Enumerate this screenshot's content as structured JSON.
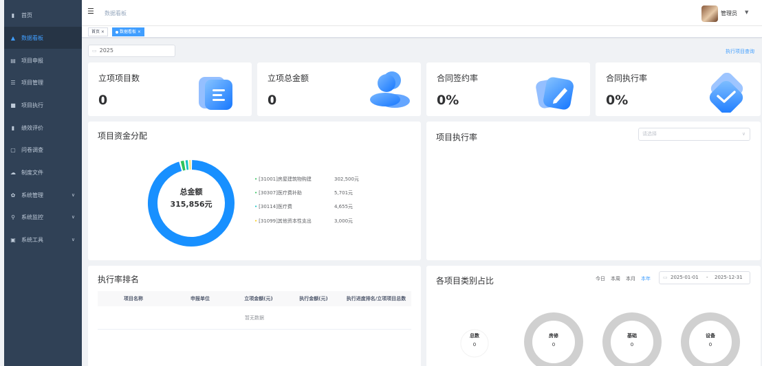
{
  "sidebar": {
    "items": [
      {
        "label": "首页",
        "icon": "dashboard-icon"
      },
      {
        "label": "数据看板",
        "icon": "chart-icon",
        "active": true
      },
      {
        "label": "项目申报",
        "icon": "document-icon"
      },
      {
        "label": "项目管理",
        "icon": "list-icon"
      },
      {
        "label": "项目执行",
        "icon": "square-icon"
      },
      {
        "label": "绩效评价",
        "icon": "rating-icon"
      },
      {
        "label": "问卷调查",
        "icon": "survey-icon"
      },
      {
        "label": "制度文件",
        "icon": "cloud-icon"
      },
      {
        "label": "系统管理",
        "icon": "gear-icon",
        "expandable": true
      },
      {
        "label": "系统监控",
        "icon": "monitor-icon",
        "expandable": true
      },
      {
        "label": "系统工具",
        "icon": "toolbox-icon",
        "expandable": true
      }
    ]
  },
  "header": {
    "breadcrumb": "数据看板",
    "user": "管理员"
  },
  "tags": [
    {
      "label": "首页 ×"
    },
    {
      "label": "数据看板 ×",
      "active": true
    }
  ],
  "filter": {
    "year": "2025",
    "query_link": "执行项目查询"
  },
  "stats": [
    {
      "title": "立项项目数",
      "value": "0",
      "icon": "document-3d-icon"
    },
    {
      "title": "立项总金额",
      "value": "0",
      "icon": "user-3d-icon"
    },
    {
      "title": "合同签约率",
      "value": "0%",
      "icon": "edit-3d-icon"
    },
    {
      "title": "合同执行率",
      "value": "0%",
      "icon": "check-3d-icon"
    }
  ],
  "fund_panel": {
    "title": "项目资金分配",
    "center_label": "总金额",
    "center_value": "315,856元",
    "legend": [
      {
        "name": "[31001]房屋建筑物购建",
        "amount": "302,500元",
        "color": "#1890ff"
      },
      {
        "name": "[30307]医疗费补助",
        "amount": "5,701元",
        "color": "#2fc25b"
      },
      {
        "name": "[30114]医疗费",
        "amount": "4,655元",
        "color": "#13c2c2"
      },
      {
        "name": "[31099]其他资本性支出",
        "amount": "3,000元",
        "color": "#facc14"
      }
    ]
  },
  "chart_data": {
    "type": "pie",
    "title": "项目资金分配",
    "categories": [
      "[31001]房屋建筑物购建",
      "[30307]医疗费补助",
      "[30114]医疗费",
      "[31099]其他资本性支出"
    ],
    "values": [
      302500,
      5701,
      4655,
      3000
    ],
    "total": 315856
  },
  "exec_panel": {
    "title": "项目执行率",
    "select_placeholder": "请选择"
  },
  "rank_panel": {
    "title": "执行率排名",
    "columns": [
      "项目名称",
      "申报单位",
      "立项金额(元)",
      "执行金额(元)",
      "执行进度排名/立项项目总数"
    ],
    "empty_text": "暂无数据"
  },
  "category_panel": {
    "title": "各项目类别占比",
    "quick": [
      "今日",
      "本周",
      "本月",
      "本年"
    ],
    "range_start": "2025-01-01",
    "range_sep": "-",
    "range_end": "2025-12-31",
    "rings": [
      {
        "label": "总数",
        "value": "0"
      },
      {
        "label": "房修",
        "value": "0"
      },
      {
        "label": "基础",
        "value": "0"
      },
      {
        "label": "设备",
        "value": "0"
      }
    ]
  }
}
